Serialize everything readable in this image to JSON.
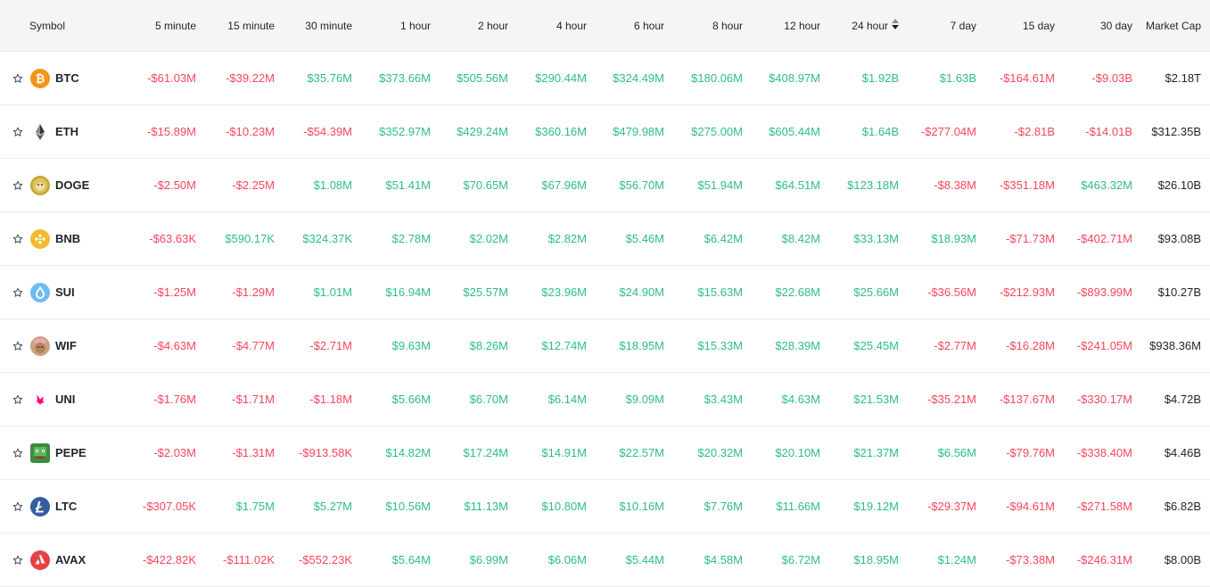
{
  "headers": {
    "symbol": "Symbol",
    "m5": "5 minute",
    "m15": "15 minute",
    "m30": "30 minute",
    "h1": "1 hour",
    "h2": "2 hour",
    "h4": "4 hour",
    "h6": "6 hour",
    "h8": "8 hour",
    "h12": "12 hour",
    "h24": "24 hour",
    "d7": "7 day",
    "d15": "15 day",
    "d30": "30 day",
    "mcap": "Market Cap"
  },
  "colors": {
    "negative": "#f6465d",
    "positive": "#2ebd85",
    "text": "#1e2329",
    "header_bg": "#f5f5f5"
  },
  "rows": [
    {
      "symbol": "BTC",
      "icon": "btc-icon",
      "values": [
        "-$61.03M",
        "-$39.22M",
        "$35.76M",
        "$373.66M",
        "$505.56M",
        "$290.44M",
        "$324.49M",
        "$180.06M",
        "$408.97M",
        "$1.92B",
        "$1.63B",
        "-$164.61M",
        "-$9.03B"
      ],
      "mcap": "$2.18T"
    },
    {
      "symbol": "ETH",
      "icon": "eth-icon",
      "values": [
        "-$15.89M",
        "-$10.23M",
        "-$54.39M",
        "$352.97M",
        "$429.24M",
        "$360.16M",
        "$479.98M",
        "$275.00M",
        "$605.44M",
        "$1.64B",
        "-$277.04M",
        "-$2.81B",
        "-$14.01B"
      ],
      "mcap": "$312.35B"
    },
    {
      "symbol": "DOGE",
      "icon": "doge-icon",
      "values": [
        "-$2.50M",
        "-$2.25M",
        "$1.08M",
        "$51.41M",
        "$70.65M",
        "$67.96M",
        "$56.70M",
        "$51.94M",
        "$64.51M",
        "$123.18M",
        "-$8.38M",
        "-$351.18M",
        "$463.32M"
      ],
      "mcap": "$26.10B"
    },
    {
      "symbol": "BNB",
      "icon": "bnb-icon",
      "values": [
        "-$63.63K",
        "$590.17K",
        "$324.37K",
        "$2.78M",
        "$2.02M",
        "$2.82M",
        "$5.46M",
        "$6.42M",
        "$8.42M",
        "$33.13M",
        "$18.93M",
        "-$71.73M",
        "-$402.71M"
      ],
      "mcap": "$93.08B"
    },
    {
      "symbol": "SUI",
      "icon": "sui-icon",
      "values": [
        "-$1.25M",
        "-$1.29M",
        "$1.01M",
        "$16.94M",
        "$25.57M",
        "$23.96M",
        "$24.90M",
        "$15.63M",
        "$22.68M",
        "$25.66M",
        "-$36.56M",
        "-$212.93M",
        "-$893.99M"
      ],
      "mcap": "$10.27B"
    },
    {
      "symbol": "WIF",
      "icon": "wif-icon",
      "values": [
        "-$4.63M",
        "-$4.77M",
        "-$2.71M",
        "$9.63M",
        "$8.26M",
        "$12.74M",
        "$18.95M",
        "$15.33M",
        "$28.39M",
        "$25.45M",
        "-$2.77M",
        "-$16.28M",
        "-$241.05M"
      ],
      "mcap": "$938.36M"
    },
    {
      "symbol": "UNI",
      "icon": "uni-icon",
      "values": [
        "-$1.76M",
        "-$1.71M",
        "-$1.18M",
        "$5.66M",
        "$6.70M",
        "$6.14M",
        "$9.09M",
        "$3.43M",
        "$4.63M",
        "$21.53M",
        "-$35.21M",
        "-$137.67M",
        "-$330.17M"
      ],
      "mcap": "$4.72B"
    },
    {
      "symbol": "PEPE",
      "icon": "pepe-icon",
      "values": [
        "-$2.03M",
        "-$1.31M",
        "-$913.58K",
        "$14.82M",
        "$17.24M",
        "$14.91M",
        "$22.57M",
        "$20.32M",
        "$20.10M",
        "$21.37M",
        "$6.56M",
        "-$79.76M",
        "-$338.40M"
      ],
      "mcap": "$4.46B"
    },
    {
      "symbol": "LTC",
      "icon": "ltc-icon",
      "values": [
        "-$307.05K",
        "$1.75M",
        "$5.27M",
        "$10.56M",
        "$11.13M",
        "$10.80M",
        "$10.16M",
        "$7.76M",
        "$11.66M",
        "$19.12M",
        "-$29.37M",
        "-$94.61M",
        "-$271.58M"
      ],
      "mcap": "$6.82B"
    },
    {
      "symbol": "AVAX",
      "icon": "avax-icon",
      "values": [
        "-$422.82K",
        "-$111.02K",
        "-$552.23K",
        "$5.64M",
        "$6.99M",
        "$6.06M",
        "$5.44M",
        "$4.58M",
        "$6.72M",
        "$18.95M",
        "$1.24M",
        "-$73.38M",
        "-$246.31M"
      ],
      "mcap": "$8.00B"
    }
  ]
}
